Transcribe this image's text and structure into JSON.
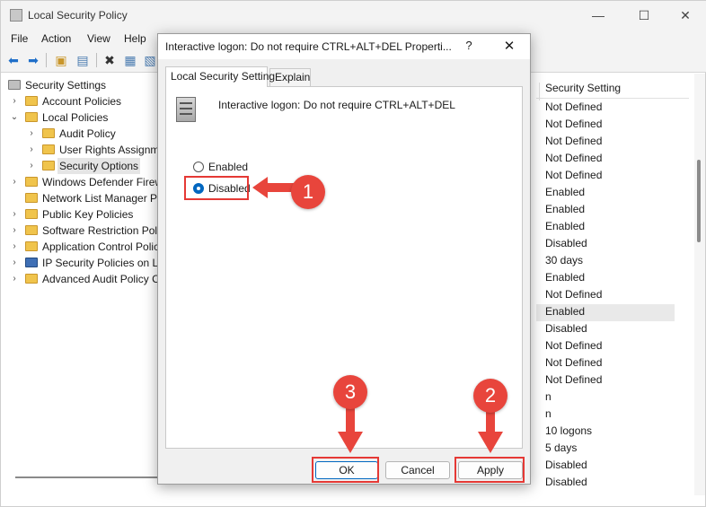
{
  "window": {
    "title": "Local Security Policy",
    "minimize": "—",
    "maximize": "☐",
    "close": "✕"
  },
  "menu": [
    "File",
    "Action",
    "View",
    "Help"
  ],
  "toolbar_icons": [
    "back-arrow-icon",
    "forward-arrow-icon",
    "up-folder-icon",
    "show-hide-tree-icon",
    "delete-icon",
    "properties-icon",
    "export-list-icon",
    "help-icon"
  ],
  "tree": [
    {
      "label": "Security Settings",
      "level": 0,
      "icon": "security-settings-icon"
    },
    {
      "label": "Account Policies",
      "level": 1,
      "icon": "folder-icon",
      "chevron": "›"
    },
    {
      "label": "Local Policies",
      "level": 1,
      "icon": "folder-icon",
      "chevron": "⌄"
    },
    {
      "label": "Audit Policy",
      "level": 2,
      "icon": "folder-icon",
      "chevron": "›"
    },
    {
      "label": "User Rights Assignme",
      "level": 2,
      "icon": "folder-icon",
      "chevron": "›"
    },
    {
      "label": "Security Options",
      "level": 2,
      "icon": "folder-icon",
      "chevron": "›",
      "selected": true
    },
    {
      "label": "Windows Defender Firew",
      "level": 1,
      "icon": "folder-icon",
      "chevron": "›"
    },
    {
      "label": "Network List Manager Po",
      "level": 1,
      "icon": "folder-icon"
    },
    {
      "label": "Public Key Policies",
      "level": 1,
      "icon": "folder-icon",
      "chevron": "›"
    },
    {
      "label": "Software Restriction Poli",
      "level": 1,
      "icon": "folder-icon",
      "chevron": "›"
    },
    {
      "label": "Application Control Polic",
      "level": 1,
      "icon": "folder-icon",
      "chevron": "›"
    },
    {
      "label": "IP Security Policies on Lo",
      "level": 1,
      "icon": "ip-security-icon",
      "chevron": "›"
    },
    {
      "label": "Advanced Audit Policy C",
      "level": 1,
      "icon": "folder-icon",
      "chevron": "›"
    }
  ],
  "settings_column": {
    "header": "Security Setting",
    "values": [
      "Not Defined",
      "Not Defined",
      "Not Defined",
      "Not Defined",
      "Not Defined",
      "Enabled",
      "Enabled",
      "Enabled",
      "Disabled",
      "30 days",
      "Enabled",
      "Not Defined",
      "Enabled",
      "Disabled",
      "Not Defined",
      "Not Defined",
      "Not Defined",
      "n",
      "n",
      "10 logons",
      "5 days",
      "Disabled",
      "Disabled"
    ]
  },
  "dialog": {
    "title": "Interactive logon: Do not require CTRL+ALT+DEL Properti...",
    "help": "?",
    "close": "✕",
    "tabs": [
      "Local Security Setting",
      "Explain"
    ],
    "policy_name": "Interactive logon: Do not require CTRL+ALT+DEL",
    "options": [
      {
        "label": "Enabled",
        "checked": false
      },
      {
        "label": "Disabled",
        "checked": true
      }
    ],
    "buttons": {
      "ok": "OK",
      "cancel": "Cancel",
      "apply": "Apply"
    }
  },
  "annotations": {
    "marker_color": "#e8453c",
    "markers": [
      "1",
      "2",
      "3"
    ]
  }
}
